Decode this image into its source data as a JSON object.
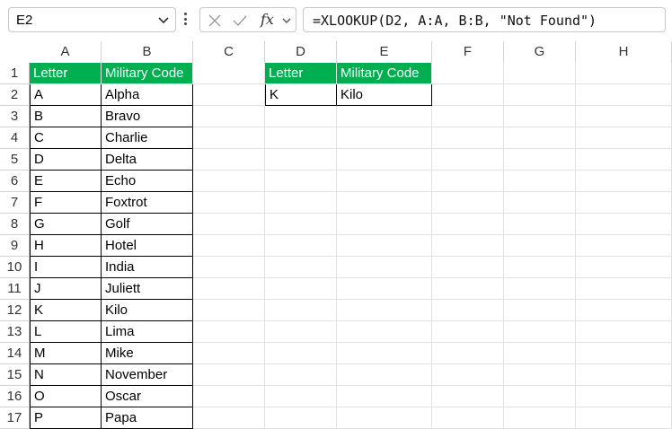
{
  "namebox": {
    "value": "E2"
  },
  "formula_bar": {
    "fx_label": "fx",
    "formula": "=XLOOKUP(D2, A:A, B:B, \"Not Found\")"
  },
  "columns": [
    "A",
    "B",
    "C",
    "D",
    "E",
    "F",
    "G",
    "H"
  ],
  "rows": [
    "1",
    "2",
    "3",
    "4",
    "5",
    "6",
    "7",
    "8",
    "9",
    "10",
    "11",
    "12",
    "13",
    "14",
    "15",
    "16",
    "17"
  ],
  "table_main": {
    "headers": [
      "Letter",
      "Military Code"
    ],
    "rows": [
      [
        "A",
        "Alpha"
      ],
      [
        "B",
        "Bravo"
      ],
      [
        "C",
        "Charlie"
      ],
      [
        "D",
        "Delta"
      ],
      [
        "E",
        "Echo"
      ],
      [
        "F",
        "Foxtrot"
      ],
      [
        "G",
        "Golf"
      ],
      [
        "H",
        "Hotel"
      ],
      [
        "I",
        "India"
      ],
      [
        "J",
        "Juliett"
      ],
      [
        "K",
        "Kilo"
      ],
      [
        "L",
        "Lima"
      ],
      [
        "M",
        "Mike"
      ],
      [
        "N",
        "November"
      ],
      [
        "O",
        "Oscar"
      ],
      [
        "P",
        "Papa"
      ]
    ]
  },
  "table_lookup": {
    "headers": [
      "Letter",
      "Military Code"
    ],
    "row": [
      "K",
      "Kilo"
    ]
  },
  "colors": {
    "header_fill": "#00b050",
    "header_text": "#ffffff",
    "selection": "#107c41"
  }
}
